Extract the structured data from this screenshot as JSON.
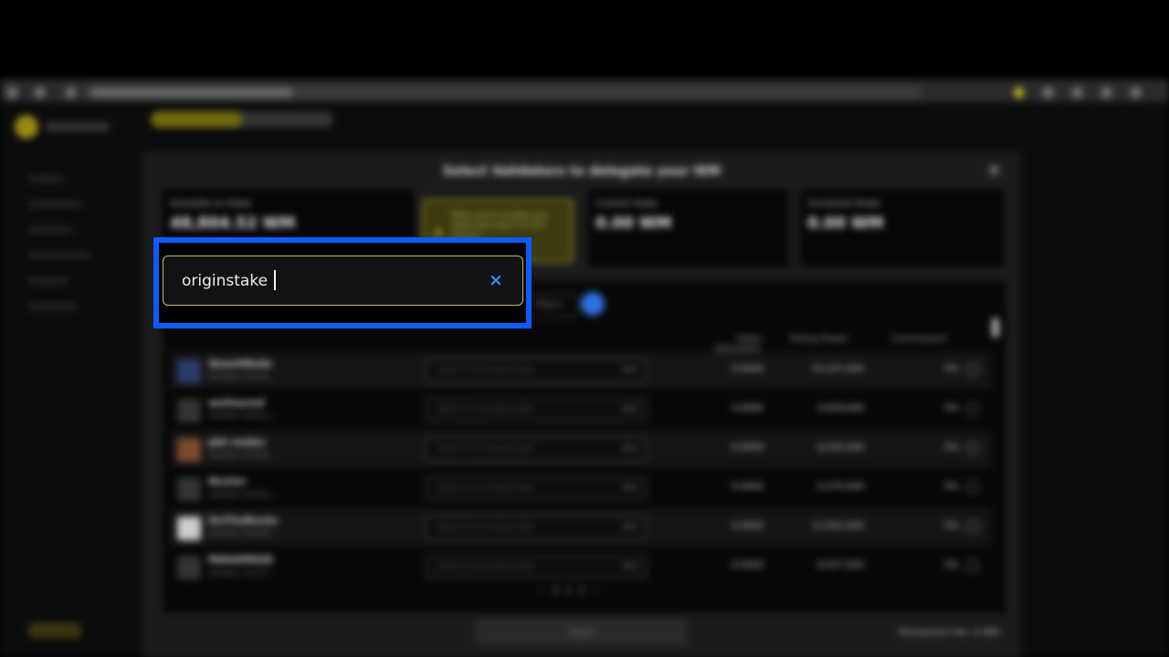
{
  "modal": {
    "title": "Select Validators to delegate your WM",
    "close_icon": "×",
    "stats": [
      {
        "label": "Available to Stake",
        "value": "48,804.52 WM"
      },
      {
        "label": "Current Stake",
        "value": "0.00 WM"
      },
      {
        "label": "Increased Stake",
        "value": "0.00 WM"
      }
    ],
    "warning": "Make sure to re-stake your stake every epoch to earn rewards...",
    "filter_label": "Filters",
    "columns": [
      "Stake Saturation",
      "Voting Power",
      "Commission"
    ],
    "validators": [
      {
        "name": "QuantNode",
        "sub": "Validator 0x7a2f...",
        "color": "#2a3a6a",
        "saturation": "0.0000",
        "power": "15,247,000",
        "commission": "5%"
      },
      {
        "name": "wellsaved",
        "sub": "Validator 0x8c1e...",
        "color": "#333333",
        "saturation": "0.0000",
        "power": "4,818,000",
        "commission": "5%"
      },
      {
        "name": "pbt nodes",
        "sub": "Validator 0x3f92...",
        "color": "#7a4a30",
        "saturation": "0.0000",
        "power": "6,205,000",
        "commission": "5%"
      },
      {
        "name": "Nexter",
        "sub": "Validator 0x55ba...",
        "color": "#333333",
        "saturation": "0.0000",
        "power": "5,270,000",
        "commission": "5%"
      },
      {
        "name": "OnTheRocks",
        "sub": "Validator 0x9d04...",
        "color": "#cccccc",
        "saturation": "0.0000",
        "power": "12,043,000",
        "commission": "5%"
      },
      {
        "name": "PARAMNOD",
        "sub": "Validator 0x1b7c...",
        "color": "#333333",
        "saturation": "0.0000",
        "power": "8,227,000",
        "commission": "5%"
      }
    ],
    "input_placeholder": "Select % to increase stake",
    "input_max": "MAX",
    "pager": {
      "prev": "‹",
      "pages": [
        "1",
        "2",
        "3"
      ],
      "next": "›"
    },
    "apply_label": "Next",
    "fee_label": "Transaction fee: 0 WM"
  },
  "search": {
    "value": "originstake",
    "clear_icon": "×"
  }
}
